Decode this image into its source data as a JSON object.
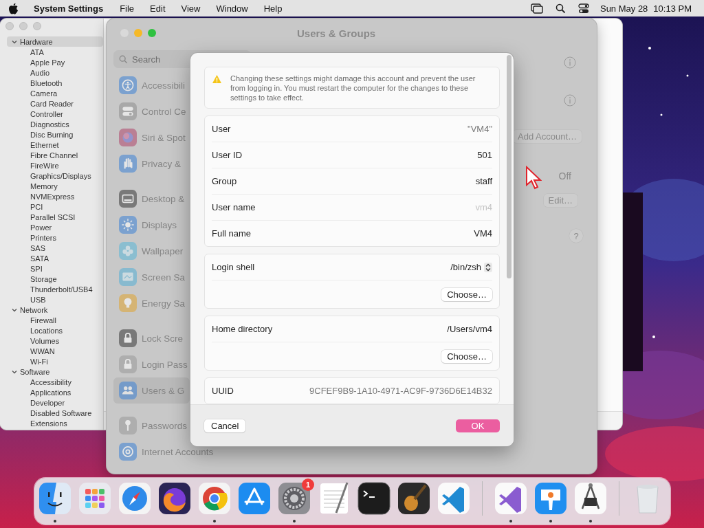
{
  "menu_bar": {
    "app_name": "System Settings",
    "menus": [
      "File",
      "Edit",
      "View",
      "Window",
      "Help"
    ],
    "date": "Sun May 28",
    "time": "10:13 PM"
  },
  "system_information": {
    "tree": [
      {
        "label": "Hardware",
        "expanded": true,
        "selected": true,
        "children": [
          {
            "label": "ATA",
            "selected": false
          },
          {
            "label": "Apple Pay",
            "selected": false
          },
          {
            "label": "Audio",
            "selected": false
          },
          {
            "label": "Bluetooth",
            "selected": false
          },
          {
            "label": "Camera",
            "selected": false
          },
          {
            "label": "Card Reader",
            "selected": false
          },
          {
            "label": "Controller",
            "selected": false
          },
          {
            "label": "Diagnostics",
            "selected": false
          },
          {
            "label": "Disc Burning",
            "selected": false
          },
          {
            "label": "Ethernet",
            "selected": false
          },
          {
            "label": "Fibre Channel",
            "selected": false
          },
          {
            "label": "FireWire",
            "selected": false
          },
          {
            "label": "Graphics/Displays",
            "selected": false
          },
          {
            "label": "Memory",
            "selected": false
          },
          {
            "label": "NVMExpress",
            "selected": false
          },
          {
            "label": "PCI",
            "selected": false
          },
          {
            "label": "Parallel SCSI",
            "selected": false
          },
          {
            "label": "Power",
            "selected": false
          },
          {
            "label": "Printers",
            "selected": false
          },
          {
            "label": "SAS",
            "selected": false
          },
          {
            "label": "SATA",
            "selected": false
          },
          {
            "label": "SPI",
            "selected": false
          },
          {
            "label": "Storage",
            "selected": false
          },
          {
            "label": "Thunderbolt/USB4",
            "selected": false
          },
          {
            "label": "USB",
            "selected": false
          }
        ]
      },
      {
        "label": "Network",
        "expanded": true,
        "selected": false,
        "children": [
          {
            "label": "Firewall",
            "selected": false
          },
          {
            "label": "Locations",
            "selected": false
          },
          {
            "label": "Volumes",
            "selected": false
          },
          {
            "label": "WWAN",
            "selected": false
          },
          {
            "label": "Wi-Fi",
            "selected": false
          }
        ]
      },
      {
        "label": "Software",
        "expanded": true,
        "selected": false,
        "children": [
          {
            "label": "Accessibility",
            "selected": false
          },
          {
            "label": "Applications",
            "selected": false
          },
          {
            "label": "Developer",
            "selected": false
          },
          {
            "label": "Disabled Software",
            "selected": false
          },
          {
            "label": "Extensions",
            "selected": false
          }
        ]
      }
    ]
  },
  "settings_window": {
    "title": "Users & Groups",
    "search": {
      "placeholder": "Search"
    },
    "sidebar_groups": [
      {
        "items": [
          {
            "label": "Accessibili",
            "selected": false
          },
          {
            "label": "Control Ce",
            "selected": false
          },
          {
            "label": "Siri & Spot",
            "selected": false
          },
          {
            "label": "Privacy &",
            "selected": false
          }
        ]
      },
      {
        "items": [
          {
            "label": "Desktop &",
            "selected": false
          },
          {
            "label": "Displays",
            "selected": false
          },
          {
            "label": "Wallpaper",
            "selected": false
          },
          {
            "label": "Screen Sa",
            "selected": false
          },
          {
            "label": "Energy Sa",
            "selected": false
          }
        ]
      },
      {
        "items": [
          {
            "label": "Lock Scre",
            "selected": false
          },
          {
            "label": "Login Pass",
            "selected": false
          },
          {
            "label": "Users & G",
            "selected": true
          }
        ]
      },
      {
        "items": [
          {
            "label": "Passwords",
            "selected": false
          },
          {
            "label": "Internet Accounts",
            "selected": false
          }
        ]
      }
    ],
    "panel": {
      "add_account": "Add Account…",
      "auto_login": "Off",
      "edit": "Edit…",
      "help": "?"
    }
  },
  "sheet": {
    "warning": "Changing these settings might damage this account and prevent the user from logging in. You must restart the computer for the changes to these settings to take effect.",
    "details": [
      {
        "label": "User",
        "value": "\"VM4\"",
        "editable": false,
        "disabled": false
      },
      {
        "label": "User ID",
        "value": "501",
        "editable": true,
        "disabled": false
      },
      {
        "label": "Group",
        "value": "staff",
        "editable": true,
        "disabled": false
      },
      {
        "label": "User name",
        "value": "vm4",
        "editable": true,
        "disabled": true
      },
      {
        "label": "Full name",
        "value": "VM4",
        "editable": true,
        "disabled": false
      }
    ],
    "login_shell": {
      "label": "Login shell",
      "value": "/bin/zsh",
      "button": "Choose…"
    },
    "home_directory": {
      "label": "Home directory",
      "value": "/Users/vm4",
      "button": "Choose…"
    },
    "uuid": {
      "label": "UUID",
      "value": "9CFEF9B9-1A10-4971-AC9F-9736D6E14B32"
    },
    "cancel": "Cancel",
    "ok": "OK"
  },
  "dock": {
    "items": [
      {
        "running": true
      },
      {
        "running": false
      },
      {
        "running": false
      },
      {
        "running": false
      },
      {
        "running": true
      },
      {
        "running": false
      },
      {
        "running": true,
        "badge": "1"
      },
      {
        "running": false
      },
      {
        "running": false
      },
      {
        "running": false
      },
      {
        "running": false
      },
      {
        "running": true
      },
      {
        "running": true
      },
      {
        "running": true
      },
      {
        "running": false
      }
    ]
  }
}
